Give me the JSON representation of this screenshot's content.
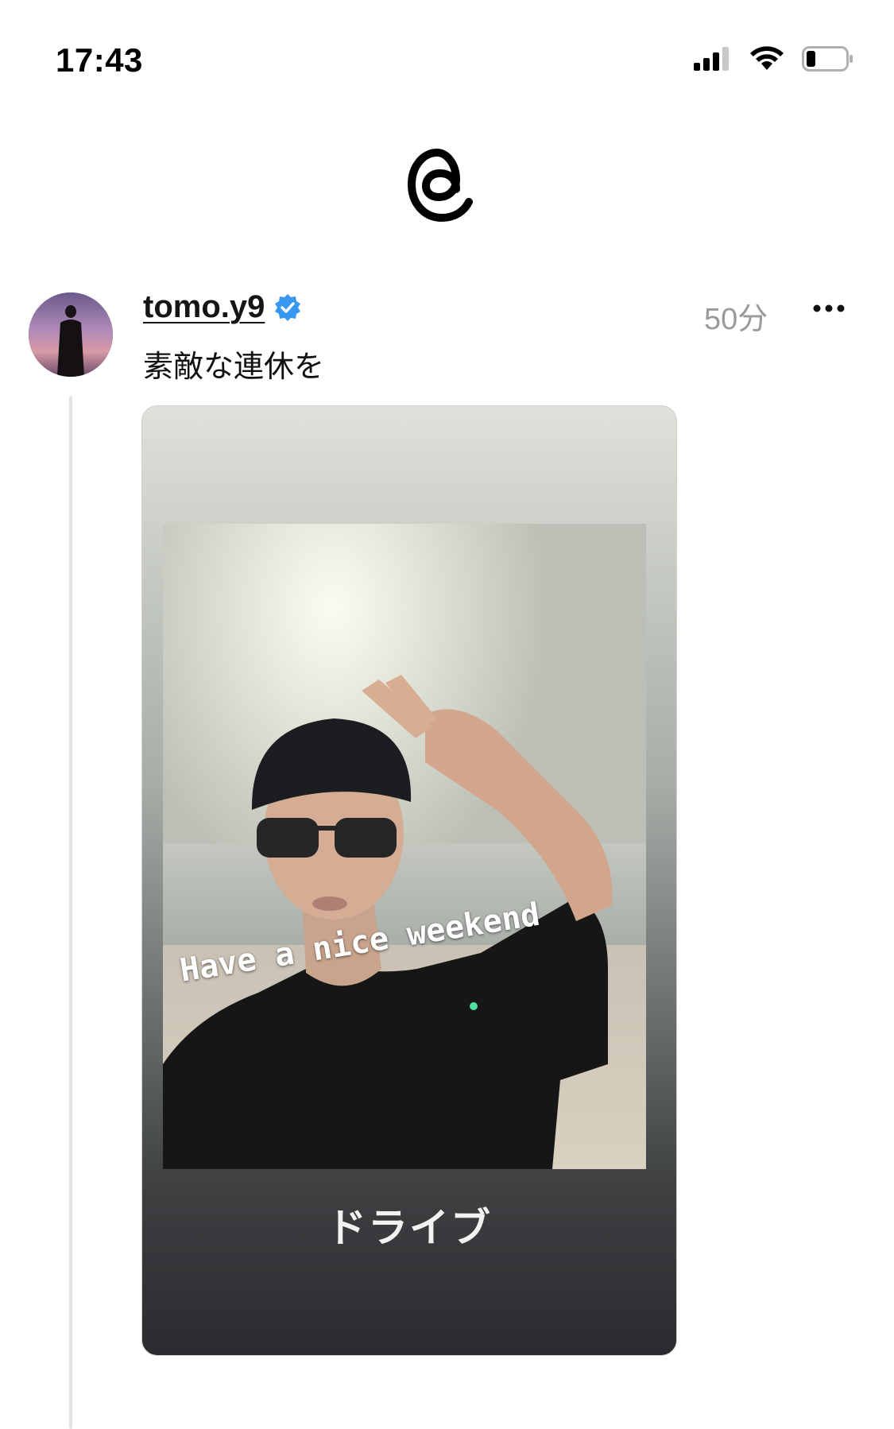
{
  "status_bar": {
    "time": "17:43",
    "icons": [
      "cellular-signal-icon",
      "wifi-icon",
      "battery-icon"
    ]
  },
  "app": {
    "logo": "threads-logo-icon"
  },
  "post": {
    "username": "tomo.y9",
    "verified": true,
    "time": "50分",
    "text": "素敵な連休を",
    "media": {
      "caption": "Have a nice weekend",
      "label": "ドライブ"
    }
  },
  "colors": {
    "verified": "#3897f0",
    "muted_text": "#9a9a9a",
    "thread_line": "#e3e3e3"
  }
}
